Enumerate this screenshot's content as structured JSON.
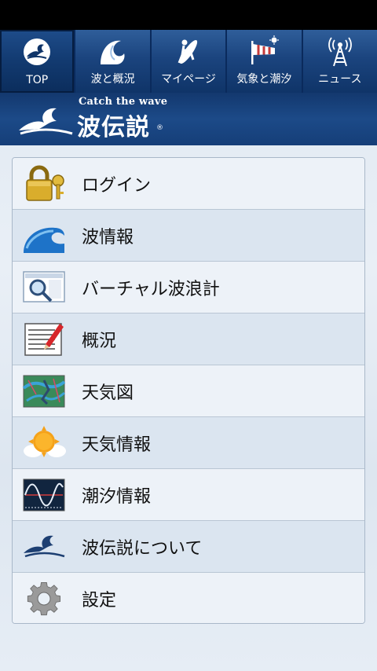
{
  "tabs": [
    {
      "label": "TOP",
      "icon": "surf-logo-icon"
    },
    {
      "label": "波と概況",
      "icon": "wave-icon"
    },
    {
      "label": "マイページ",
      "icon": "surfer-icon"
    },
    {
      "label": "気象と潮汐",
      "icon": "windsock-icon"
    },
    {
      "label": "ニュース",
      "icon": "antenna-icon"
    }
  ],
  "brand": {
    "tagline": "Catch the wave",
    "name": "波伝説",
    "reg": "®"
  },
  "menu": [
    {
      "label": "ログイン",
      "icon": "padlock-icon"
    },
    {
      "label": "波情報",
      "icon": "wave-icon"
    },
    {
      "label": "バーチャル波浪計",
      "icon": "magnifier-map-icon"
    },
    {
      "label": "概況",
      "icon": "notepad-pencil-icon"
    },
    {
      "label": "天気図",
      "icon": "weather-map-icon"
    },
    {
      "label": "天気情報",
      "icon": "sun-cloud-icon"
    },
    {
      "label": "潮汐情報",
      "icon": "tide-graph-icon"
    },
    {
      "label": "波伝説について",
      "icon": "surf-logo-icon"
    },
    {
      "label": "設定",
      "icon": "gear-icon"
    }
  ],
  "colors": {
    "nav_bg": "#0a2a5c",
    "tab_top": "#2f5e9a",
    "brand_bg": "#1c4a88",
    "menu_bg": "#e9f0f7"
  }
}
